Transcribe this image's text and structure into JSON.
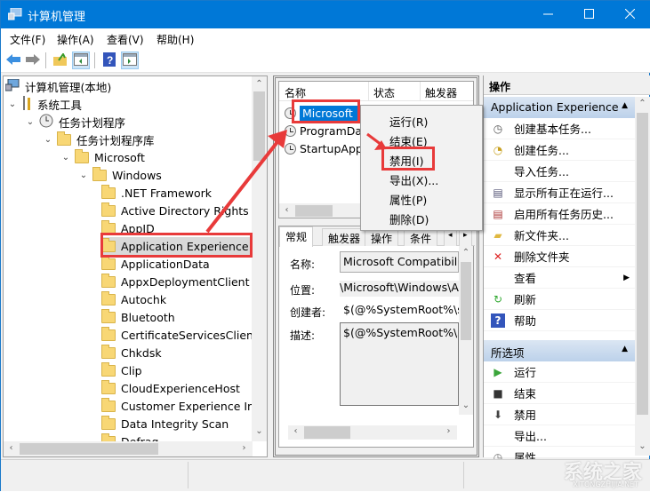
{
  "window": {
    "title": "计算机管理",
    "minimize_icon": "minimize-icon",
    "maximize_icon": "maximize-icon",
    "close_icon": "close-icon"
  },
  "menu": {
    "items": [
      "文件(F)",
      "操作(A)",
      "查看(V)",
      "帮助(H)"
    ]
  },
  "toolbar": {
    "icons": [
      "back-arrow-icon",
      "forward-arrow-icon",
      "up-folder-icon",
      "show-hide-tree-icon",
      "help-icon",
      "show-hide-action-pane-icon"
    ]
  },
  "tree": {
    "root": "计算机管理(本地)",
    "system_tools": "系统工具",
    "task_scheduler": "任务计划程序",
    "task_library": "任务计划程序库",
    "microsoft": "Microsoft",
    "windows": "Windows",
    "folders": [
      ".NET Framework",
      "Active Directory Rights M",
      "AppID",
      "Application Experience",
      "ApplicationData",
      "AppxDeploymentClient",
      "Autochk",
      "Bluetooth",
      "CertificateServicesClient",
      "Chkdsk",
      "Clip",
      "CloudExperienceHost",
      "Customer Experience Im",
      "Data Integrity Scan",
      "Defrag"
    ],
    "selected": "Application Experience"
  },
  "task_list": {
    "columns": [
      "名称",
      "状态",
      "触发器"
    ],
    "rows": [
      {
        "name": "Microsoft ...",
        "selected": true
      },
      {
        "name": "ProgramDa...",
        "selected": false
      },
      {
        "name": "StartupApp...",
        "selected": false
      }
    ]
  },
  "context_menu": {
    "items": [
      "运行(R)",
      "结束(E)",
      "禁用(I)",
      "导出(X)...",
      "属性(P)",
      "删除(D)"
    ],
    "highlighted": "禁用(I)"
  },
  "detail": {
    "tabs": [
      "常规",
      "触发器",
      "操作",
      "条件"
    ],
    "active_tab": "常规",
    "name_label": "名称:",
    "name_value": "Microsoft Compatibilit",
    "location_label": "位置:",
    "location_value": "\\Microsoft\\Windows\\A",
    "author_label": "创建者:",
    "author_value": "$(@%SystemRoot%\\sy",
    "description_label": "描述:",
    "description_value": "$(@%SystemRoot%\\sy"
  },
  "actions": {
    "header": "操作",
    "group1_title": "Application Experience",
    "group1_items": [
      {
        "label": "创建基本任务...",
        "icon": "create-basic-task-icon"
      },
      {
        "label": "创建任务...",
        "icon": "create-task-icon"
      },
      {
        "label": "导入任务...",
        "icon": ""
      },
      {
        "label": "显示所有正在运行...",
        "icon": "running-tasks-icon"
      },
      {
        "label": "启用所有任务历史...",
        "icon": "task-history-icon"
      },
      {
        "label": "新文件夹...",
        "icon": "new-folder-icon"
      },
      {
        "label": "删除文件夹",
        "icon": "delete-icon"
      },
      {
        "label": "查看",
        "icon": "",
        "submenu": true
      },
      {
        "label": "刷新",
        "icon": "refresh-icon"
      },
      {
        "label": "帮助",
        "icon": "help-icon"
      }
    ],
    "group2_title": "所选项",
    "group2_items": [
      {
        "label": "运行",
        "icon": "run-icon"
      },
      {
        "label": "结束",
        "icon": "stop-icon"
      },
      {
        "label": "禁用",
        "icon": "disable-icon"
      },
      {
        "label": "导出...",
        "icon": ""
      },
      {
        "label": "属性",
        "icon": "properties-icon"
      }
    ]
  },
  "watermark": {
    "text": "系统之家",
    "sub": "XITONGZHIJIA.NET"
  }
}
